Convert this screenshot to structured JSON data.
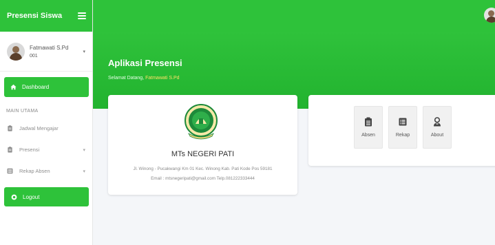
{
  "sidebar": {
    "brand": "Presensi Siswa",
    "user": {
      "name": "Fatmawati S.Pd",
      "id": "001"
    },
    "dashboard_label": "Dashboard",
    "section_title": "MAIN UTAMA",
    "items": [
      {
        "label": "Jadwal Mengajar",
        "icon": "clipboard-icon",
        "has_caret": false
      },
      {
        "label": "Presensi",
        "icon": "clipboard-icon",
        "has_caret": true
      },
      {
        "label": "Rekap Absen",
        "icon": "list-icon",
        "has_caret": true
      }
    ],
    "logout_label": "Logout",
    "caret": "▾"
  },
  "banner": {
    "title": "Aplikasi Presensi",
    "welcome_prefix": "Selamat Datang,",
    "welcome_name": "Fatmawati S.Pd"
  },
  "school": {
    "name": "MTs NEGERI PATI",
    "address": "Jl. Winong - Pucakwangi Km 01 Kec. Winong Kab. Pati Kode Pos 59181",
    "contact": "Email : mtsnegeripati@gmail.com Telp.081222333444"
  },
  "menu": {
    "tiles": [
      {
        "label": "Absen",
        "icon": "clipboard-icon"
      },
      {
        "label": "Rekap",
        "icon": "list-icon"
      },
      {
        "label": "About",
        "icon": "user-icon"
      }
    ]
  },
  "colors": {
    "accent": "#2ec23a",
    "highlight": "#ffe066"
  }
}
